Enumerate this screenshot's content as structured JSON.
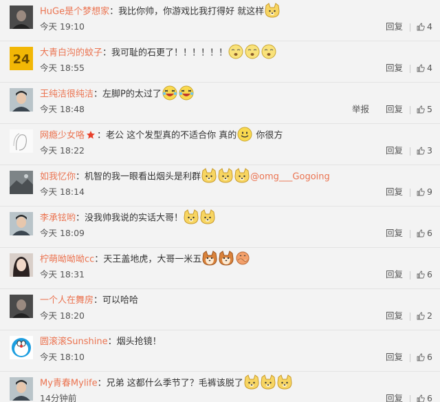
{
  "comments": [
    {
      "user": "HuGe是个梦想家",
      "text": "我比你帅，你游戏比我打得好 就这样",
      "time": "今天 19:10",
      "reply": "回复",
      "likes": "4",
      "emojis": [
        "doge"
      ],
      "avatar": "dark-portrait"
    },
    {
      "user": "大青白沟的蚊子",
      "text": "我可耻的石更了！！！！！！",
      "time": "今天 18:55",
      "reply": "回复",
      "likes": "4",
      "emojis": [
        "yawn",
        "yawn",
        "yawn"
      ],
      "avatar": "number-24",
      "avatar_text": "24"
    },
    {
      "user": "王纯洁很纯洁",
      "text": "左脚P的太过了",
      "time": "今天 18:48",
      "reply": "回复",
      "report": "举报",
      "likes": "5",
      "emojis": [
        "laugh",
        "laugh"
      ],
      "avatar": "man-portrait"
    },
    {
      "user": "网瘾少女咯",
      "text": "老公 这个发型真的不适合你 真的",
      "text_after": " 你很方",
      "time": "今天 18:22",
      "reply": "回复",
      "likes": "3",
      "badge": "star",
      "emojis": [
        "smile"
      ],
      "avatar": "sketch"
    },
    {
      "user": "如我忆你",
      "text": "机智的我一眼看出烟头是利群",
      "mention": "@omg___Gogoing",
      "time": "今天 18:14",
      "reply": "回复",
      "likes": "9",
      "emojis": [
        "doge",
        "doge",
        "doge"
      ],
      "avatar": "landscape"
    },
    {
      "user": "李承铉哟",
      "text": "没我帅我说的实话大哥！",
      "time": "今天 18:09",
      "reply": "回复",
      "likes": "6",
      "emojis": [
        "doge",
        "doge"
      ],
      "avatar": "man-portrait"
    },
    {
      "user": "柠萌呦呦呦cc",
      "text": "天王盖地虎，大哥一米五",
      "time": "今天 18:31",
      "reply": "回复",
      "likes": "6",
      "emojis": [
        "shiba",
        "shiba",
        "hug"
      ],
      "avatar": "girl-portrait"
    },
    {
      "user": "一个人在舞房",
      "text": "可以哈哈",
      "time": "今天 18:20",
      "reply": "回复",
      "likes": "2",
      "emojis": [],
      "avatar": "dark-portrait"
    },
    {
      "user": "圆滚滚Sunshine",
      "text": "烟头抢镜！",
      "time": "今天 18:10",
      "reply": "回复",
      "likes": "6",
      "emojis": [],
      "avatar": "doraemon"
    },
    {
      "user": "My青春Mylife",
      "text": "兄弟 这都什么季节了？毛裤该脱了",
      "time": "14分钟前",
      "reply": "回复",
      "likes": "6",
      "emojis": [
        "doge",
        "doge",
        "doge"
      ],
      "avatar": "man-portrait"
    }
  ],
  "colors": {
    "username": "#eb7350",
    "text": "#333333",
    "meta": "#555555",
    "background": "#f3f3f3"
  }
}
